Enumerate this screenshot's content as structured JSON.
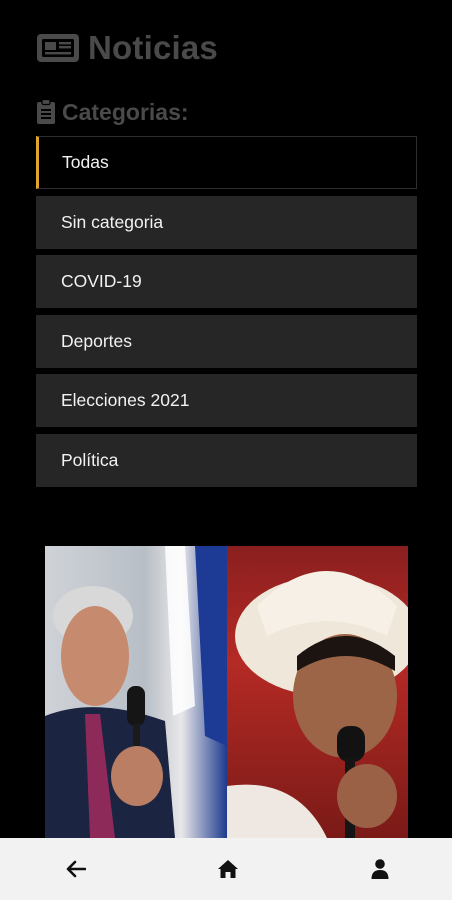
{
  "header": {
    "title": "Noticias",
    "icon": "newspaper-icon"
  },
  "categories": {
    "heading": "Categorias:",
    "icon": "clipboard-icon",
    "items": [
      {
        "label": "Todas",
        "active": true
      },
      {
        "label": "Sin categoria"
      },
      {
        "label": "COVID-19"
      },
      {
        "label": "Deportes"
      },
      {
        "label": "Elecciones 2021"
      },
      {
        "label": "Política"
      }
    ]
  },
  "colors": {
    "accent": "#e2a52b",
    "item_bg": "#262626",
    "title_gray": "#4a4a4a",
    "nav_bg": "#f2f2f2"
  },
  "bottom_nav": {
    "back_icon": "arrow-left-icon",
    "home_icon": "home-icon",
    "profile_icon": "user-icon"
  }
}
